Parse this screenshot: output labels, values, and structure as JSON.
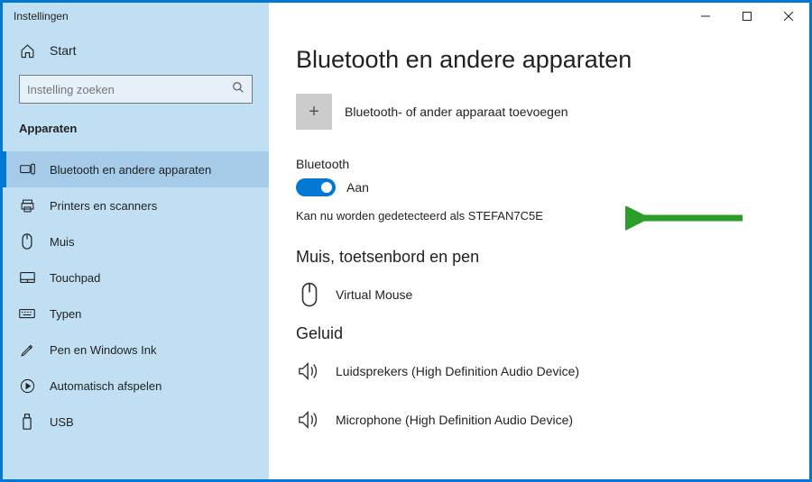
{
  "window": {
    "title": "Instellingen"
  },
  "sidebar": {
    "home": "Start",
    "search_placeholder": "Instelling zoeken",
    "section": "Apparaten",
    "items": [
      {
        "label": "Bluetooth en andere apparaten"
      },
      {
        "label": "Printers en scanners"
      },
      {
        "label": "Muis"
      },
      {
        "label": "Touchpad"
      },
      {
        "label": "Typen"
      },
      {
        "label": "Pen en Windows Ink"
      },
      {
        "label": "Automatisch afspelen"
      },
      {
        "label": "USB"
      }
    ]
  },
  "main": {
    "title": "Bluetooth en andere apparaten",
    "add_label": "Bluetooth- of ander apparaat toevoegen",
    "bt_heading": "Bluetooth",
    "bt_state": "Aan",
    "bt_detect": "Kan nu worden gedetecteerd als STEFAN7C5E",
    "group_mouse": "Muis, toetsenbord en pen",
    "device_mouse": "Virtual Mouse",
    "group_sound": "Geluid",
    "device_speakers": "Luidsprekers (High Definition Audio Device)",
    "device_mic": "Microphone (High Definition Audio Device)"
  }
}
